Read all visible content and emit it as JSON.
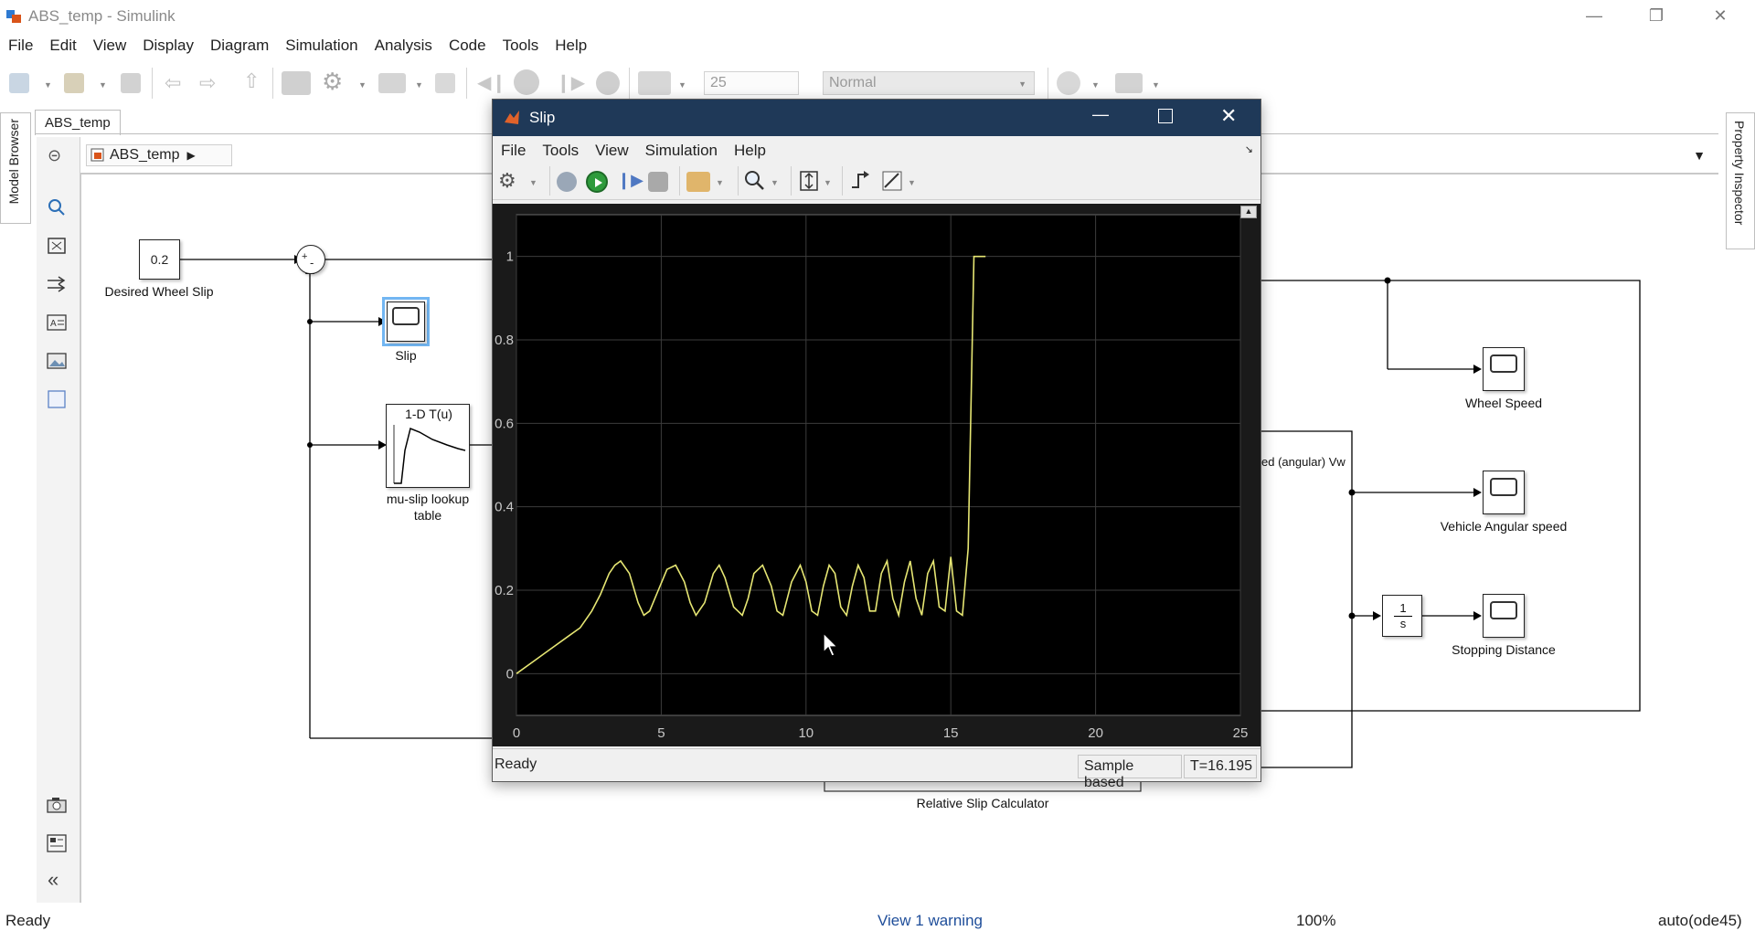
{
  "window": {
    "title": "ABS_temp - Simulink",
    "controls": {
      "minimize": "—",
      "restore": "❐",
      "close": "✕"
    }
  },
  "menubar": [
    "File",
    "Edit",
    "View",
    "Display",
    "Diagram",
    "Simulation",
    "Analysis",
    "Code",
    "Tools",
    "Help"
  ],
  "toolbar": {
    "stop_time": "25",
    "sim_mode": "Normal"
  },
  "tab": {
    "label": "ABS_temp"
  },
  "breadcrumb": {
    "model": "ABS_temp"
  },
  "side_panels": {
    "left": "Model Browser",
    "right": "Property Inspector"
  },
  "diagram": {
    "constant_value": "0.2",
    "constant_label": "Desired Wheel Slip",
    "sum_signs": [
      "+",
      "-"
    ],
    "slip_scope_label": "Slip",
    "lookup_title": "1-D T(u)",
    "lookup_label_line1": "mu-slip lookup",
    "lookup_label_line2": "table",
    "wheel_speed_label": "Wheel Speed",
    "vehicle_speed_label": "Vehicle Angular speed",
    "stopping_label": "Stopping Distance",
    "integrator_num": "1",
    "integrator_den": "s",
    "partial_signal_label": "ed (angular) Vw",
    "relative_slip_label": "Relative Slip Calculator"
  },
  "scope_window": {
    "title": "Slip",
    "menu": [
      "File",
      "Tools",
      "View",
      "Simulation",
      "Help"
    ],
    "status_left": "Ready",
    "status_mode": "Sample based",
    "status_time": "T=16.195"
  },
  "chart_data": {
    "type": "line",
    "title": "",
    "xlabel": "",
    "ylabel": "",
    "xlim": [
      0,
      25
    ],
    "ylim": [
      -0.1,
      1.1
    ],
    "x_ticks": [
      0,
      5,
      10,
      15,
      20,
      25
    ],
    "y_ticks": [
      0,
      0.2,
      0.4,
      0.6,
      0.8,
      1
    ],
    "grid": true,
    "background": "#000000",
    "line_color": "#e6e673",
    "series": [
      {
        "x": [
          0,
          0.6,
          1.2,
          1.8,
          2.2,
          2.6,
          2.9,
          3.2,
          3.4,
          3.6,
          3.9,
          4.2,
          4.4,
          4.6,
          4.9,
          5.2,
          5.5,
          5.8,
          6.0,
          6.2,
          6.5,
          6.8,
          7.0,
          7.2,
          7.5,
          7.8,
          8.0,
          8.2,
          8.5,
          8.8,
          9.0,
          9.2,
          9.5,
          9.8,
          10.0,
          10.2,
          10.4,
          10.6,
          10.8,
          11.0,
          11.2,
          11.4,
          11.6,
          11.8,
          12.0,
          12.2,
          12.4,
          12.6,
          12.8,
          13.0,
          13.2,
          13.4,
          13.6,
          13.8,
          14.0,
          14.2,
          14.4,
          14.6,
          14.8,
          15.0,
          15.2,
          15.4,
          15.6,
          15.8,
          16.2
        ],
        "y": [
          0,
          0.03,
          0.06,
          0.09,
          0.11,
          0.15,
          0.19,
          0.24,
          0.26,
          0.27,
          0.24,
          0.17,
          0.14,
          0.15,
          0.2,
          0.25,
          0.26,
          0.22,
          0.17,
          0.14,
          0.17,
          0.24,
          0.26,
          0.23,
          0.16,
          0.14,
          0.18,
          0.24,
          0.26,
          0.21,
          0.15,
          0.14,
          0.22,
          0.26,
          0.22,
          0.15,
          0.14,
          0.21,
          0.26,
          0.24,
          0.16,
          0.14,
          0.21,
          0.26,
          0.23,
          0.15,
          0.15,
          0.24,
          0.27,
          0.18,
          0.14,
          0.22,
          0.27,
          0.18,
          0.14,
          0.24,
          0.27,
          0.16,
          0.15,
          0.28,
          0.15,
          0.14,
          0.3,
          1.0,
          1.0
        ]
      }
    ]
  },
  "statusbar": {
    "left": "Ready",
    "warning": "View 1 warning",
    "zoom": "100%",
    "solver": "auto(ode45)"
  }
}
